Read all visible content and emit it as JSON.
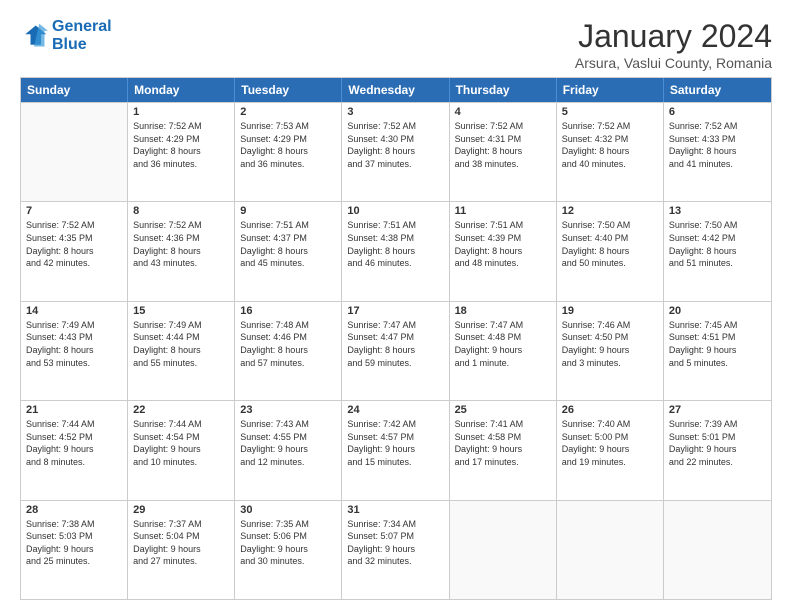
{
  "logo": {
    "line1": "General",
    "line2": "Blue"
  },
  "title": "January 2024",
  "subtitle": "Arsura, Vaslui County, Romania",
  "header_days": [
    "Sunday",
    "Monday",
    "Tuesday",
    "Wednesday",
    "Thursday",
    "Friday",
    "Saturday"
  ],
  "weeks": [
    [
      {
        "day": "",
        "empty": true,
        "lines": []
      },
      {
        "day": "1",
        "lines": [
          "Sunrise: 7:52 AM",
          "Sunset: 4:29 PM",
          "Daylight: 8 hours",
          "and 36 minutes."
        ]
      },
      {
        "day": "2",
        "lines": [
          "Sunrise: 7:53 AM",
          "Sunset: 4:29 PM",
          "Daylight: 8 hours",
          "and 36 minutes."
        ]
      },
      {
        "day": "3",
        "lines": [
          "Sunrise: 7:52 AM",
          "Sunset: 4:30 PM",
          "Daylight: 8 hours",
          "and 37 minutes."
        ]
      },
      {
        "day": "4",
        "lines": [
          "Sunrise: 7:52 AM",
          "Sunset: 4:31 PM",
          "Daylight: 8 hours",
          "and 38 minutes."
        ]
      },
      {
        "day": "5",
        "lines": [
          "Sunrise: 7:52 AM",
          "Sunset: 4:32 PM",
          "Daylight: 8 hours",
          "and 40 minutes."
        ]
      },
      {
        "day": "6",
        "lines": [
          "Sunrise: 7:52 AM",
          "Sunset: 4:33 PM",
          "Daylight: 8 hours",
          "and 41 minutes."
        ]
      }
    ],
    [
      {
        "day": "7",
        "lines": [
          "Sunrise: 7:52 AM",
          "Sunset: 4:35 PM",
          "Daylight: 8 hours",
          "and 42 minutes."
        ]
      },
      {
        "day": "8",
        "lines": [
          "Sunrise: 7:52 AM",
          "Sunset: 4:36 PM",
          "Daylight: 8 hours",
          "and 43 minutes."
        ]
      },
      {
        "day": "9",
        "lines": [
          "Sunrise: 7:51 AM",
          "Sunset: 4:37 PM",
          "Daylight: 8 hours",
          "and 45 minutes."
        ]
      },
      {
        "day": "10",
        "lines": [
          "Sunrise: 7:51 AM",
          "Sunset: 4:38 PM",
          "Daylight: 8 hours",
          "and 46 minutes."
        ]
      },
      {
        "day": "11",
        "lines": [
          "Sunrise: 7:51 AM",
          "Sunset: 4:39 PM",
          "Daylight: 8 hours",
          "and 48 minutes."
        ]
      },
      {
        "day": "12",
        "lines": [
          "Sunrise: 7:50 AM",
          "Sunset: 4:40 PM",
          "Daylight: 8 hours",
          "and 50 minutes."
        ]
      },
      {
        "day": "13",
        "lines": [
          "Sunrise: 7:50 AM",
          "Sunset: 4:42 PM",
          "Daylight: 8 hours",
          "and 51 minutes."
        ]
      }
    ],
    [
      {
        "day": "14",
        "lines": [
          "Sunrise: 7:49 AM",
          "Sunset: 4:43 PM",
          "Daylight: 8 hours",
          "and 53 minutes."
        ]
      },
      {
        "day": "15",
        "lines": [
          "Sunrise: 7:49 AM",
          "Sunset: 4:44 PM",
          "Daylight: 8 hours",
          "and 55 minutes."
        ]
      },
      {
        "day": "16",
        "lines": [
          "Sunrise: 7:48 AM",
          "Sunset: 4:46 PM",
          "Daylight: 8 hours",
          "and 57 minutes."
        ]
      },
      {
        "day": "17",
        "lines": [
          "Sunrise: 7:47 AM",
          "Sunset: 4:47 PM",
          "Daylight: 8 hours",
          "and 59 minutes."
        ]
      },
      {
        "day": "18",
        "lines": [
          "Sunrise: 7:47 AM",
          "Sunset: 4:48 PM",
          "Daylight: 9 hours",
          "and 1 minute."
        ]
      },
      {
        "day": "19",
        "lines": [
          "Sunrise: 7:46 AM",
          "Sunset: 4:50 PM",
          "Daylight: 9 hours",
          "and 3 minutes."
        ]
      },
      {
        "day": "20",
        "lines": [
          "Sunrise: 7:45 AM",
          "Sunset: 4:51 PM",
          "Daylight: 9 hours",
          "and 5 minutes."
        ]
      }
    ],
    [
      {
        "day": "21",
        "lines": [
          "Sunrise: 7:44 AM",
          "Sunset: 4:52 PM",
          "Daylight: 9 hours",
          "and 8 minutes."
        ]
      },
      {
        "day": "22",
        "lines": [
          "Sunrise: 7:44 AM",
          "Sunset: 4:54 PM",
          "Daylight: 9 hours",
          "and 10 minutes."
        ]
      },
      {
        "day": "23",
        "lines": [
          "Sunrise: 7:43 AM",
          "Sunset: 4:55 PM",
          "Daylight: 9 hours",
          "and 12 minutes."
        ]
      },
      {
        "day": "24",
        "lines": [
          "Sunrise: 7:42 AM",
          "Sunset: 4:57 PM",
          "Daylight: 9 hours",
          "and 15 minutes."
        ]
      },
      {
        "day": "25",
        "lines": [
          "Sunrise: 7:41 AM",
          "Sunset: 4:58 PM",
          "Daylight: 9 hours",
          "and 17 minutes."
        ]
      },
      {
        "day": "26",
        "lines": [
          "Sunrise: 7:40 AM",
          "Sunset: 5:00 PM",
          "Daylight: 9 hours",
          "and 19 minutes."
        ]
      },
      {
        "day": "27",
        "lines": [
          "Sunrise: 7:39 AM",
          "Sunset: 5:01 PM",
          "Daylight: 9 hours",
          "and 22 minutes."
        ]
      }
    ],
    [
      {
        "day": "28",
        "lines": [
          "Sunrise: 7:38 AM",
          "Sunset: 5:03 PM",
          "Daylight: 9 hours",
          "and 25 minutes."
        ]
      },
      {
        "day": "29",
        "lines": [
          "Sunrise: 7:37 AM",
          "Sunset: 5:04 PM",
          "Daylight: 9 hours",
          "and 27 minutes."
        ]
      },
      {
        "day": "30",
        "lines": [
          "Sunrise: 7:35 AM",
          "Sunset: 5:06 PM",
          "Daylight: 9 hours",
          "and 30 minutes."
        ]
      },
      {
        "day": "31",
        "lines": [
          "Sunrise: 7:34 AM",
          "Sunset: 5:07 PM",
          "Daylight: 9 hours",
          "and 32 minutes."
        ]
      },
      {
        "day": "",
        "empty": true,
        "lines": []
      },
      {
        "day": "",
        "empty": true,
        "lines": []
      },
      {
        "day": "",
        "empty": true,
        "lines": []
      }
    ]
  ]
}
